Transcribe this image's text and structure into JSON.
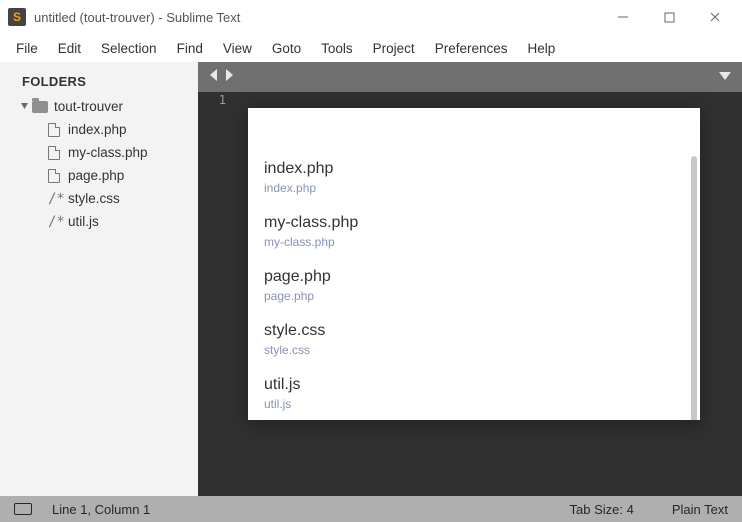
{
  "window": {
    "title": "untitled (tout-trouver) - Sublime Text"
  },
  "menus": [
    "File",
    "Edit",
    "Selection",
    "Find",
    "View",
    "Goto",
    "Tools",
    "Project",
    "Preferences",
    "Help"
  ],
  "sidebar": {
    "header": "FOLDERS",
    "root": "tout-trouver",
    "items": [
      {
        "name": "index.php",
        "icon": "file"
      },
      {
        "name": "my-class.php",
        "icon": "file"
      },
      {
        "name": "page.php",
        "icon": "file"
      },
      {
        "name": "style.css",
        "icon": "text"
      },
      {
        "name": "util.js",
        "icon": "text"
      }
    ]
  },
  "editor": {
    "line_number": "1"
  },
  "popup": {
    "results": [
      {
        "name": "index.php",
        "path": "index.php"
      },
      {
        "name": "my-class.php",
        "path": "my-class.php"
      },
      {
        "name": "page.php",
        "path": "page.php"
      },
      {
        "name": "style.css",
        "path": "style.css"
      },
      {
        "name": "util.js",
        "path": "util.js"
      }
    ]
  },
  "status": {
    "position": "Line 1, Column 1",
    "tabsize": "Tab Size: 4",
    "syntax": "Plain Text"
  }
}
